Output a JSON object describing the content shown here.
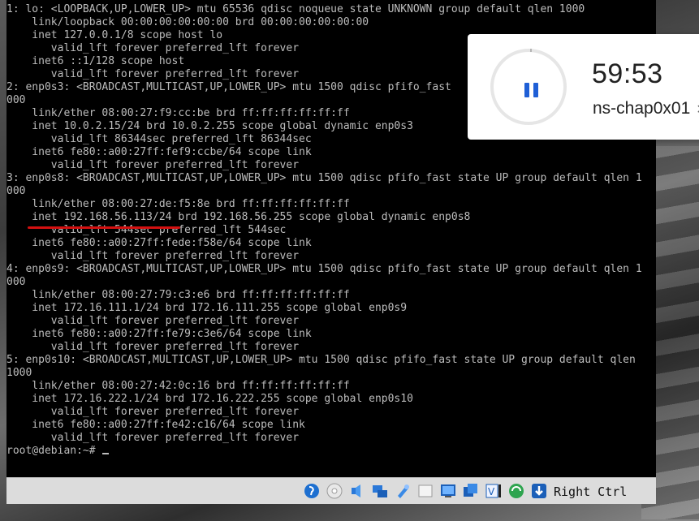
{
  "terminal": {
    "lines": [
      "1: lo: <LOOPBACK,UP,LOWER_UP> mtu 65536 qdisc noqueue state UNKNOWN group default qlen 1000",
      "    link/loopback 00:00:00:00:00:00 brd 00:00:00:00:00:00",
      "    inet 127.0.0.1/8 scope host lo",
      "       valid_lft forever preferred_lft forever",
      "    inet6 ::1/128 scope host",
      "       valid_lft forever preferred_lft forever",
      "2: enp0s3: <BROADCAST,MULTICAST,UP,LOWER_UP> mtu 1500 qdisc pfifo_fast",
      "000",
      "    link/ether 08:00:27:f9:cc:be brd ff:ff:ff:ff:ff:ff",
      "    inet 10.0.2.15/24 brd 10.0.2.255 scope global dynamic enp0s3",
      "       valid_lft 86344sec preferred_lft 86344sec",
      "    inet6 fe80::a00:27ff:fef9:ccbe/64 scope link",
      "       valid_lft forever preferred_lft forever",
      "3: enp0s8: <BROADCAST,MULTICAST,UP,LOWER_UP> mtu 1500 qdisc pfifo_fast state UP group default qlen 1",
      "000",
      "    link/ether 08:00:27:de:f5:8e brd ff:ff:ff:ff:ff:ff",
      "    inet 192.168.56.113/24 brd 192.168.56.255 scope global dynamic enp0s8",
      "       valid_lft 544sec preferred_lft 544sec",
      "    inet6 fe80::a00:27ff:fede:f58e/64 scope link",
      "       valid_lft forever preferred_lft forever",
      "4: enp0s9: <BROADCAST,MULTICAST,UP,LOWER_UP> mtu 1500 qdisc pfifo_fast state UP group default qlen 1",
      "000",
      "    link/ether 08:00:27:79:c3:e6 brd ff:ff:ff:ff:ff:ff",
      "    inet 172.16.111.1/24 brd 172.16.111.255 scope global enp0s9",
      "       valid_lft forever preferred_lft forever",
      "    inet6 fe80::a00:27ff:fe79:c3e6/64 scope link",
      "       valid_lft forever preferred_lft forever",
      "5: enp0s10: <BROADCAST,MULTICAST,UP,LOWER_UP> mtu 1500 qdisc pfifo_fast state UP group default qlen",
      "1000",
      "    link/ether 08:00:27:42:0c:16 brd ff:ff:ff:ff:ff:ff",
      "    inet 172.16.222.1/24 brd 172.16.222.255 scope global enp0s10",
      "       valid_lft forever preferred_lft forever",
      "    inet6 fe80::a00:27ff:fe42:c16/64 scope link",
      "       valid_lft forever preferred_lft forever"
    ],
    "prompt": "root@debian:~# "
  },
  "timer": {
    "time": "59:53",
    "label": "ns-chap0x01",
    "close_glyph": "×"
  },
  "statusbar": {
    "host_key": "Right Ctrl",
    "icons": [
      "mouse-integration-icon",
      "optical-disk-icon",
      "audio-icon",
      "network-icon",
      "usb-icon",
      "shared-folders-icon",
      "display-icon",
      "video-capture-icon",
      "recording-icon",
      "cpu-icon",
      "mouse-pointer-icon",
      "keyboard-capture-icon"
    ]
  },
  "colors": {
    "terminal_bg": "#000000",
    "terminal_fg": "#bcbcbc",
    "highlight_underline": "#d31010",
    "timer_accent": "#1f5fd6"
  }
}
